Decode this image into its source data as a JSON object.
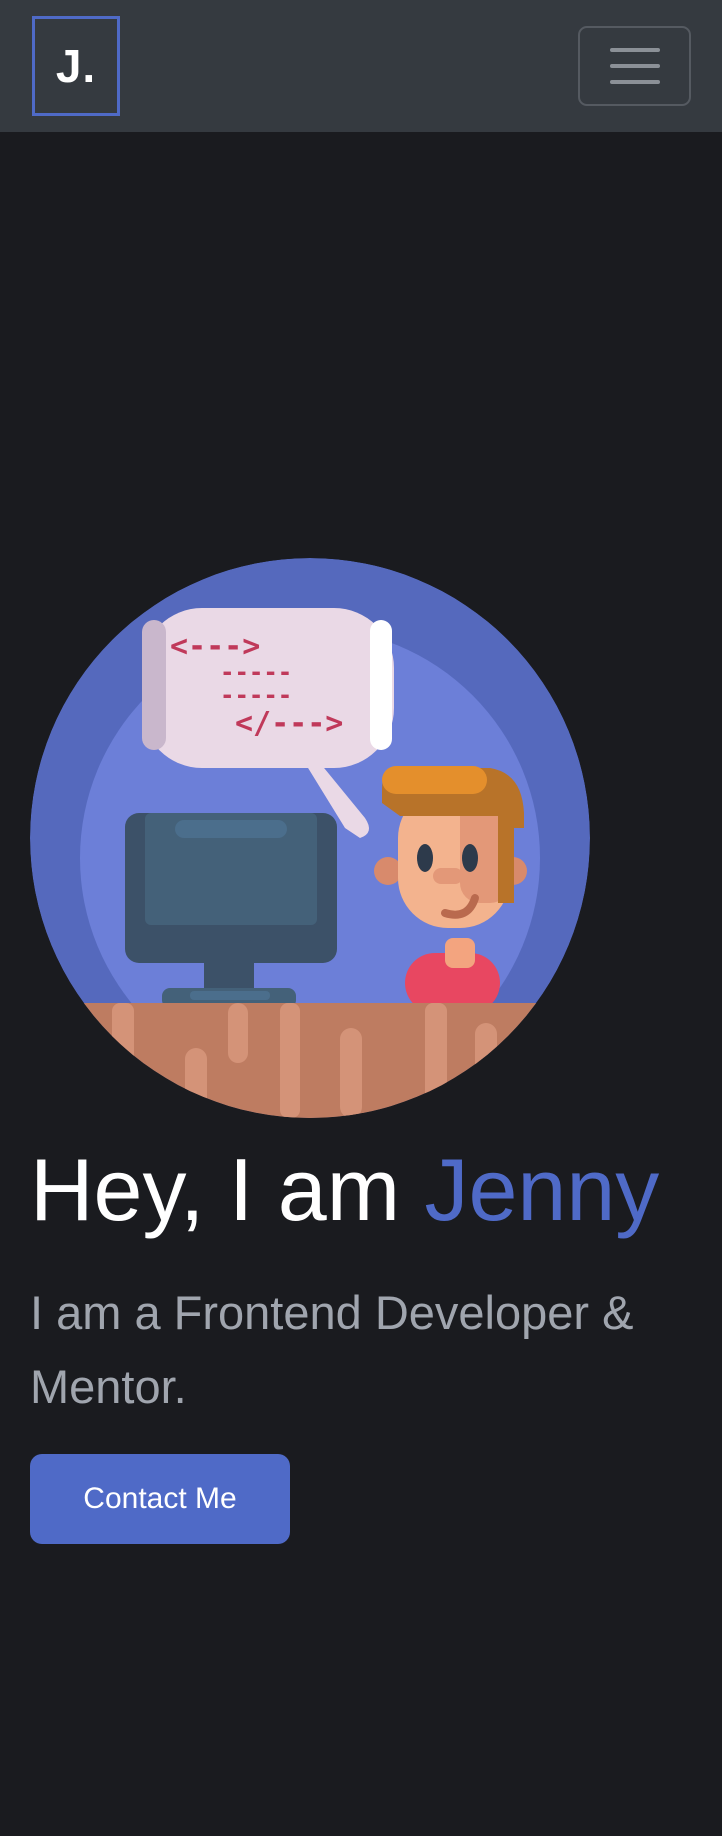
{
  "navbar": {
    "logo_text": "J.",
    "menu_toggle_icon": "hamburger-icon"
  },
  "hero": {
    "illustration_icon": "developer-at-computer-illustration",
    "speech_bubble_code": [
      "<--->",
      "-----",
      "-----",
      "</--->"
    ],
    "headline_prefix": "Hey, I am ",
    "headline_name": "Jenny",
    "subtitle": "I am a Frontend Developer & Mentor.",
    "cta_label": "Contact Me"
  },
  "colors": {
    "background": "#1a1b1f",
    "navbar": "#353a40",
    "accent": "#4f6ac7",
    "subtitle_text": "#a0a5ae",
    "code_text": "#c0395a"
  }
}
